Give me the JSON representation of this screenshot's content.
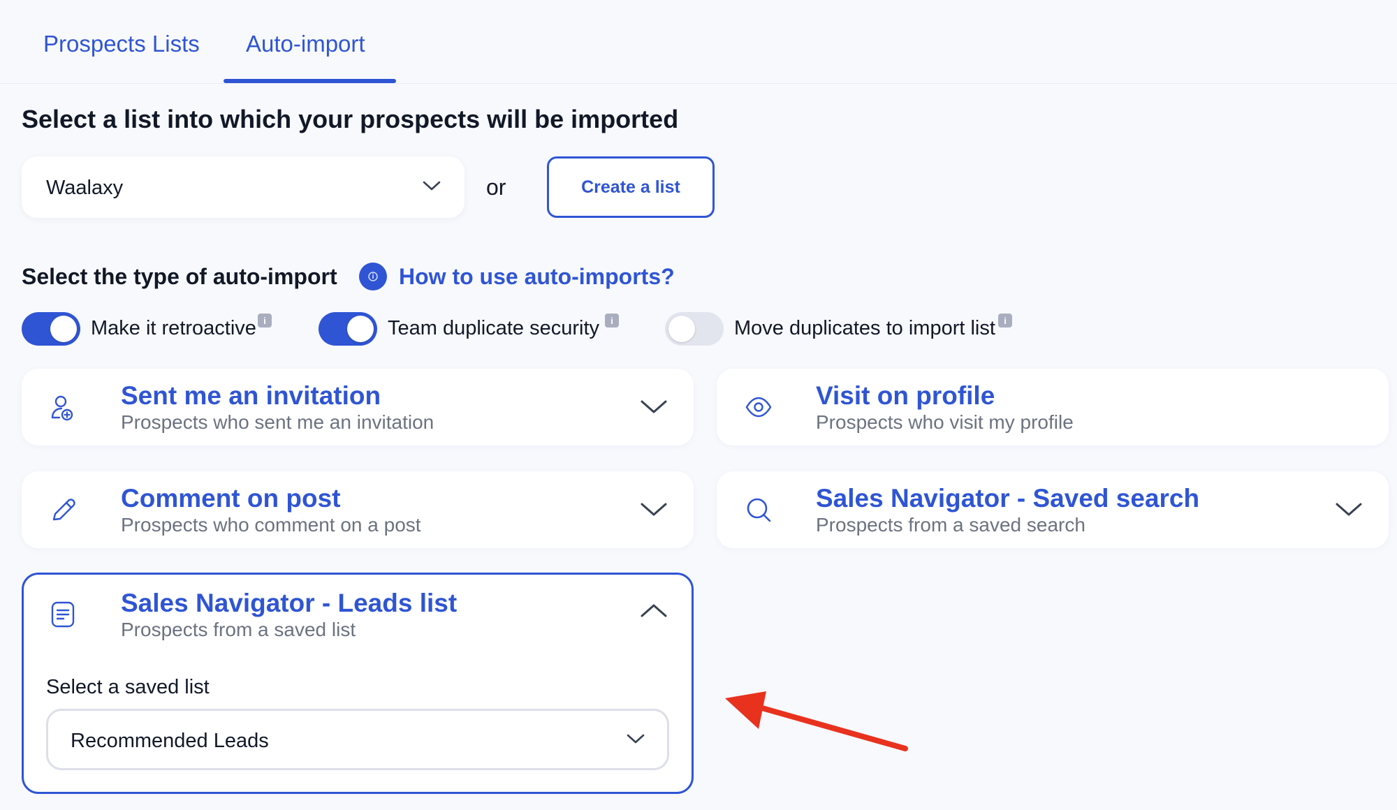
{
  "tabs": {
    "prospects_lists": "Prospects Lists",
    "auto_import": "Auto-import"
  },
  "heading": "Select a list into which your prospects will be imported",
  "list_select": {
    "value": "Waalaxy"
  },
  "or_text": "or",
  "create_list_button": "Create a list",
  "auto_import_type": {
    "title": "Select the type of auto-import",
    "help_link": "How to use auto-imports?"
  },
  "toggles": [
    {
      "label": "Make it retroactive",
      "state": "on"
    },
    {
      "label": "Team duplicate security",
      "state": "on"
    },
    {
      "label": "Move duplicates to import list",
      "state": "off"
    }
  ],
  "info_badge": "i",
  "cards": {
    "sent_invitation": {
      "title": "Sent me an invitation",
      "subtitle": "Prospects who sent me an invitation",
      "icon": "user-add-icon"
    },
    "visit_profile": {
      "title": "Visit on profile",
      "subtitle": "Prospects who visit my profile",
      "icon": "eye-icon"
    },
    "comment_post": {
      "title": "Comment on post",
      "subtitle": "Prospects who comment on a post",
      "icon": "pencil-icon"
    },
    "saved_search": {
      "title": "Sales Navigator - Saved search",
      "subtitle": "Prospects from a saved search",
      "icon": "search-icon"
    },
    "leads_list": {
      "title": "Sales Navigator - Leads list",
      "subtitle": "Prospects from a saved list",
      "icon": "document-icon"
    }
  },
  "saved_list": {
    "label": "Select a saved list",
    "value": "Recommended Leads"
  },
  "colors": {
    "accent": "#2f55d4",
    "background": "#f8f9fd",
    "annotation_arrow": "#e8321e"
  }
}
